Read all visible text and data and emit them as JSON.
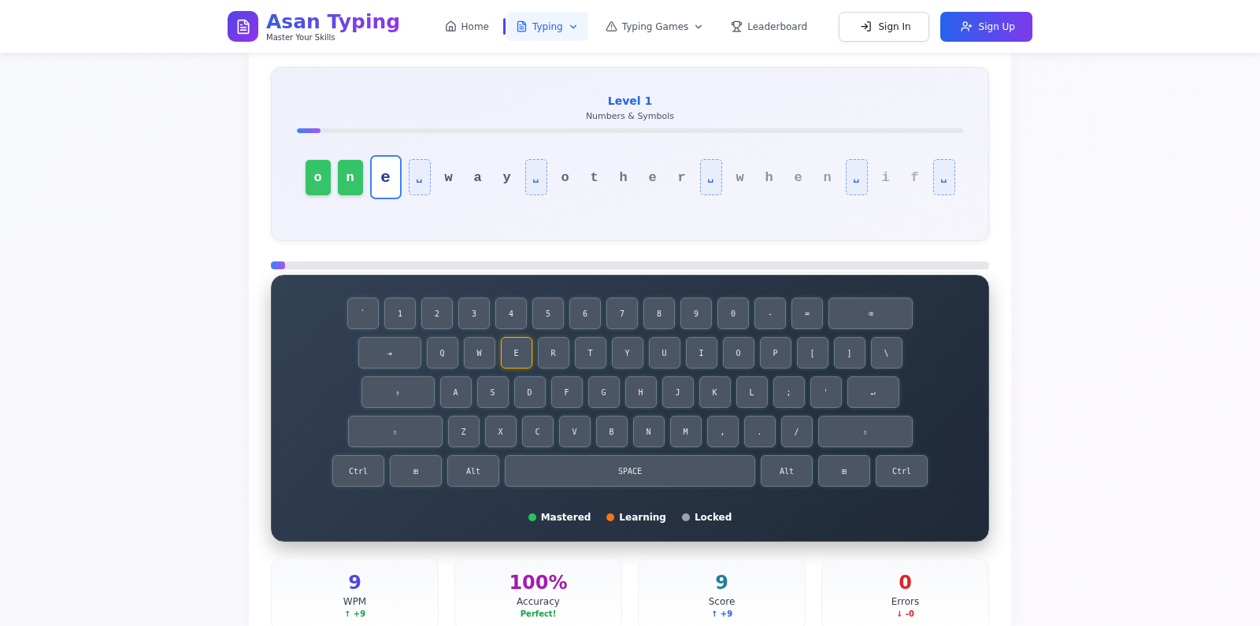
{
  "brand": {
    "title": "Asan Typing",
    "subtitle": "Master Your Skills"
  },
  "nav": [
    {
      "label": "Home",
      "selected": false,
      "dropdown": false
    },
    {
      "label": "Typing",
      "selected": true,
      "dropdown": true
    },
    {
      "label": "Typing Games",
      "selected": false,
      "dropdown": true
    },
    {
      "label": "Leaderboard",
      "selected": false,
      "dropdown": false
    }
  ],
  "auth": [
    {
      "label": "Sign In",
      "kind": "outline"
    },
    {
      "label": "Sign Up",
      "kind": "primary"
    }
  ],
  "lesson": {
    "title": "Level 1",
    "subtitle": "Numbers & Symbols",
    "level": 0.035,
    "chars": [
      {
        "char": "o",
        "correct": true,
        "selected": false,
        "kind": "letter"
      },
      {
        "char": "n",
        "correct": true,
        "selected": false,
        "kind": "letter"
      },
      {
        "char": "e",
        "correct": false,
        "selected": true,
        "kind": "letter"
      },
      {
        "char": "␣",
        "correct": false,
        "selected": false,
        "kind": "space"
      },
      {
        "char": "w",
        "correct": false,
        "selected": false,
        "kind": "letter"
      },
      {
        "char": "a",
        "correct": false,
        "selected": false,
        "kind": "letter"
      },
      {
        "char": "y",
        "correct": false,
        "selected": false,
        "kind": "letter"
      },
      {
        "char": "␣",
        "correct": false,
        "selected": false,
        "kind": "space"
      },
      {
        "char": "o",
        "correct": false,
        "selected": false,
        "kind": "letter"
      },
      {
        "char": "t",
        "correct": false,
        "selected": false,
        "kind": "letter"
      },
      {
        "char": "h",
        "correct": false,
        "selected": false,
        "kind": "letter"
      },
      {
        "char": "e",
        "correct": false,
        "selected": false,
        "kind": "letter"
      },
      {
        "char": "r",
        "correct": false,
        "selected": false,
        "kind": "letter"
      },
      {
        "char": "␣",
        "correct": false,
        "selected": false,
        "kind": "space"
      },
      {
        "char": "w",
        "correct": false,
        "selected": false,
        "kind": "letter"
      },
      {
        "char": "h",
        "correct": false,
        "selected": false,
        "kind": "letter"
      },
      {
        "char": "e",
        "correct": false,
        "selected": false,
        "kind": "letter"
      },
      {
        "char": "n",
        "correct": false,
        "selected": false,
        "kind": "letter"
      },
      {
        "char": "␣",
        "correct": false,
        "selected": false,
        "kind": "space"
      },
      {
        "char": "i",
        "correct": false,
        "selected": false,
        "kind": "letter"
      },
      {
        "char": "f",
        "correct": false,
        "selected": false,
        "kind": "letter"
      },
      {
        "char": "␣",
        "correct": false,
        "selected": false,
        "kind": "space"
      }
    ]
  },
  "session": {
    "level": 0.02
  },
  "keyboard": {
    "rows": [
      [
        {
          "label": "`",
          "kind": "key",
          "highlighted": false
        },
        {
          "label": "1",
          "kind": "key",
          "highlighted": false
        },
        {
          "label": "2",
          "kind": "key",
          "highlighted": false
        },
        {
          "label": "3",
          "kind": "key",
          "highlighted": false
        },
        {
          "label": "4",
          "kind": "key",
          "highlighted": false
        },
        {
          "label": "5",
          "kind": "key",
          "highlighted": false
        },
        {
          "label": "6",
          "kind": "key",
          "highlighted": false
        },
        {
          "label": "7",
          "kind": "key",
          "highlighted": false
        },
        {
          "label": "8",
          "kind": "key",
          "highlighted": false
        },
        {
          "label": "9",
          "kind": "key",
          "highlighted": false
        },
        {
          "label": "0",
          "kind": "key",
          "highlighted": false
        },
        {
          "label": "-",
          "kind": "key",
          "highlighted": false
        },
        {
          "label": "=",
          "kind": "key",
          "highlighted": false
        },
        {
          "label": "⌫",
          "kind": "backspace",
          "highlighted": false
        }
      ],
      [
        {
          "label": "⇥",
          "kind": "tab",
          "highlighted": false
        },
        {
          "label": "Q",
          "kind": "key",
          "highlighted": false
        },
        {
          "label": "W",
          "kind": "key",
          "highlighted": false
        },
        {
          "label": "E",
          "kind": "key",
          "highlighted": true
        },
        {
          "label": "R",
          "kind": "key",
          "highlighted": false
        },
        {
          "label": "T",
          "kind": "key",
          "highlighted": false
        },
        {
          "label": "Y",
          "kind": "key",
          "highlighted": false
        },
        {
          "label": "U",
          "kind": "key",
          "highlighted": false
        },
        {
          "label": "I",
          "kind": "key",
          "highlighted": false
        },
        {
          "label": "O",
          "kind": "key",
          "highlighted": false
        },
        {
          "label": "P",
          "kind": "key",
          "highlighted": false
        },
        {
          "label": "[",
          "kind": "key",
          "highlighted": false
        },
        {
          "label": "]",
          "kind": "key",
          "highlighted": false
        },
        {
          "label": "\\",
          "kind": "key",
          "highlighted": false
        }
      ],
      [
        {
          "label": "⇪",
          "kind": "caps",
          "highlighted": false
        },
        {
          "label": "A",
          "kind": "key",
          "highlighted": false
        },
        {
          "label": "S",
          "kind": "key",
          "highlighted": false
        },
        {
          "label": "D",
          "kind": "key",
          "highlighted": false
        },
        {
          "label": "F",
          "kind": "key",
          "highlighted": false
        },
        {
          "label": "G",
          "kind": "key",
          "highlighted": false
        },
        {
          "label": "H",
          "kind": "key",
          "highlighted": false
        },
        {
          "label": "J",
          "kind": "key",
          "highlighted": false
        },
        {
          "label": "K",
          "kind": "key",
          "highlighted": false
        },
        {
          "label": "L",
          "kind": "key",
          "highlighted": false
        },
        {
          "label": ";",
          "kind": "key",
          "highlighted": false
        },
        {
          "label": "'",
          "kind": "key",
          "highlighted": false
        },
        {
          "label": "↵",
          "kind": "enter",
          "highlighted": false
        }
      ],
      [
        {
          "label": "⇧",
          "kind": "shift",
          "highlighted": false
        },
        {
          "label": "Z",
          "kind": "key",
          "highlighted": false
        },
        {
          "label": "X",
          "kind": "key",
          "highlighted": false
        },
        {
          "label": "C",
          "kind": "key",
          "highlighted": false
        },
        {
          "label": "V",
          "kind": "key",
          "highlighted": false
        },
        {
          "label": "B",
          "kind": "key",
          "highlighted": false
        },
        {
          "label": "N",
          "kind": "key",
          "highlighted": false
        },
        {
          "label": "M",
          "kind": "key",
          "highlighted": false
        },
        {
          "label": ",",
          "kind": "key",
          "highlighted": false
        },
        {
          "label": ".",
          "kind": "key",
          "highlighted": false
        },
        {
          "label": "/",
          "kind": "key",
          "highlighted": false
        },
        {
          "label": "⇧",
          "kind": "shift",
          "highlighted": false
        }
      ],
      [
        {
          "label": "Ctrl",
          "kind": "mod",
          "highlighted": false
        },
        {
          "label": "⊞",
          "kind": "mod",
          "highlighted": false
        },
        {
          "label": "Alt",
          "kind": "mod",
          "highlighted": false
        },
        {
          "label": "SPACE",
          "kind": "space",
          "highlighted": false
        },
        {
          "label": "Alt",
          "kind": "mod",
          "highlighted": false
        },
        {
          "label": "⊞",
          "kind": "mod",
          "highlighted": false
        },
        {
          "label": "Ctrl",
          "kind": "mod",
          "highlighted": false
        }
      ]
    ],
    "legend": [
      {
        "label": "Mastered",
        "color": "#22c55e"
      },
      {
        "label": "Learning",
        "color": "#f97316"
      },
      {
        "label": "Locked",
        "color": "#9ca3af"
      }
    ]
  },
  "stats": [
    {
      "value": "9",
      "label": "WPM",
      "change": "↑ +9",
      "kind": "wpm"
    },
    {
      "value": "100%",
      "label": "Accuracy",
      "change": "Perfect!",
      "kind": "accuracy"
    },
    {
      "value": "9",
      "label": "Score",
      "change": "↑ +9",
      "kind": "score"
    },
    {
      "value": "0",
      "label": "Errors",
      "change": "↓ -0",
      "kind": "errors"
    }
  ]
}
